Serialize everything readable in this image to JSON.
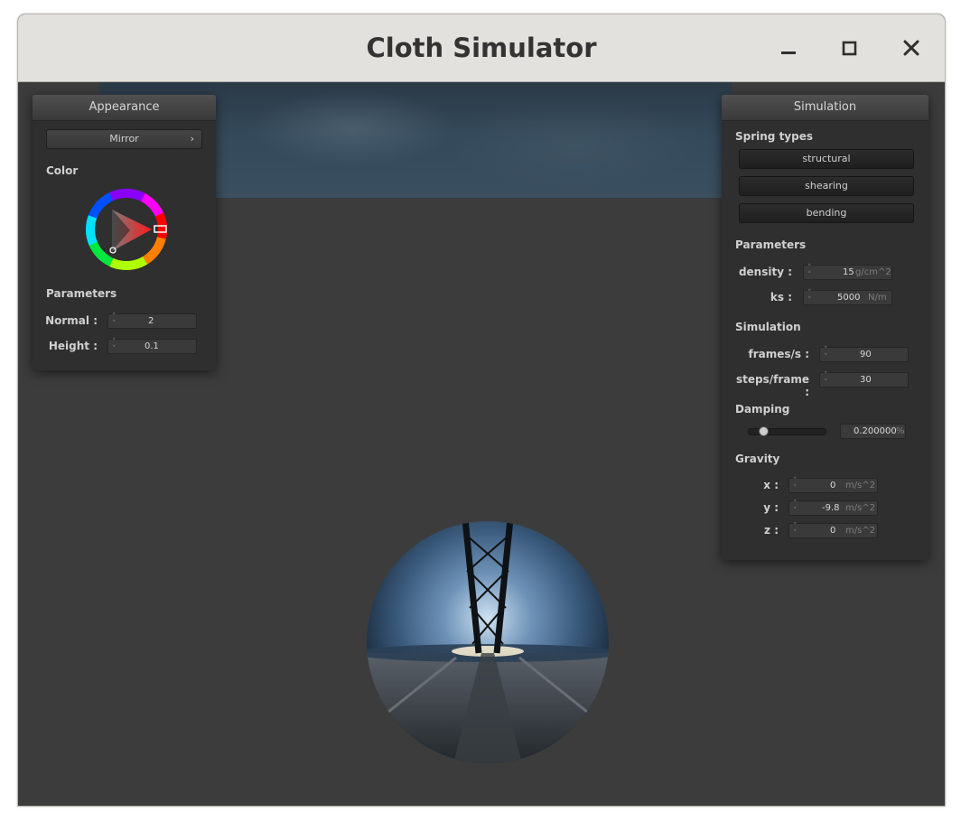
{
  "window": {
    "title": "Cloth Simulator",
    "controls": [
      "minimize-icon",
      "maximize-icon",
      "close-icon"
    ]
  },
  "appearance": {
    "header": "Appearance",
    "shader_dropdown": {
      "selected": "Mirror",
      "icon": "chevron-right-icon"
    },
    "color_label": "Color",
    "color_wheel": {
      "hue_color": "#ff2020",
      "icon": "color-wheel"
    },
    "parameters_label": "Parameters",
    "fields": [
      {
        "label": "Normal :",
        "value": "2"
      },
      {
        "label": "Height :",
        "value": "0.1"
      }
    ]
  },
  "simulation": {
    "header": "Simulation",
    "spring_types_label": "Spring types",
    "spring_buttons": [
      "structural",
      "shearing",
      "bending"
    ],
    "parameters_label": "Parameters",
    "parameters": [
      {
        "label": "density :",
        "value": "15",
        "unit": "g/cm^2"
      },
      {
        "label": "ks :",
        "value": "5000",
        "unit": "N/m"
      }
    ],
    "simulation_label": "Simulation",
    "sim_fields": [
      {
        "label": "frames/s :",
        "value": "90"
      },
      {
        "label": "steps/frame :",
        "value": "30"
      }
    ],
    "damping_label": "Damping",
    "damping": {
      "value": "0.200000",
      "unit": "%",
      "slider_fraction": 0.2
    },
    "gravity_label": "Gravity",
    "gravity": [
      {
        "label": "x :",
        "value": "0",
        "unit": "m/s^2"
      },
      {
        "label": "y :",
        "value": "-9.8",
        "unit": "m/s^2"
      },
      {
        "label": "z :",
        "value": "0",
        "unit": "m/s^2"
      }
    ]
  },
  "scene": {
    "object": "mirror-sphere",
    "background_color": "#3c3c3c"
  }
}
